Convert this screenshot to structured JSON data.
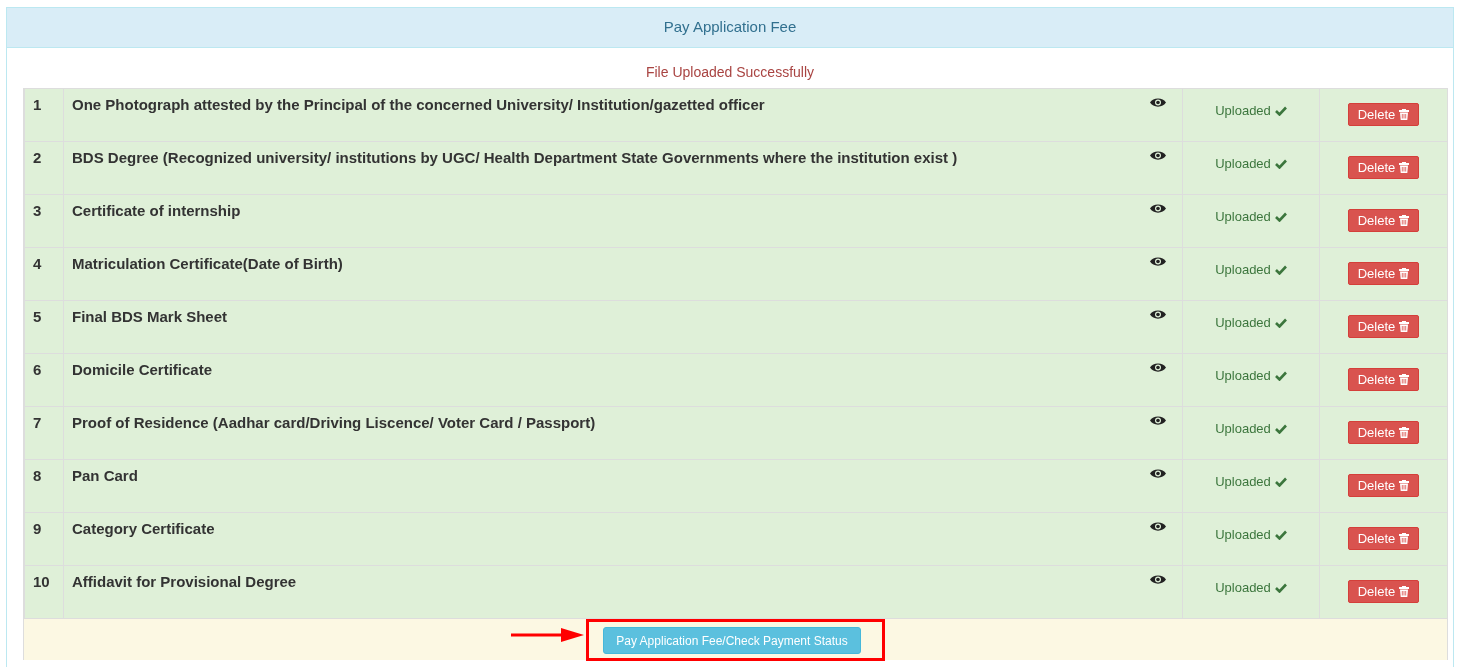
{
  "panel": {
    "title": "Pay Application Fee",
    "message": "File Uploaded Successfully"
  },
  "documents": [
    {
      "number": "1",
      "name": "One Photograph attested by the Principal of the concerned University/ Institution/gazetted officer",
      "status": "Uploaded",
      "action": "Delete"
    },
    {
      "number": "2",
      "name": "BDS Degree (Recognized university/ institutions by UGC/ Health Department State Governments where the institution exist )",
      "status": "Uploaded",
      "action": "Delete"
    },
    {
      "number": "3",
      "name": "Certificate of internship",
      "status": "Uploaded",
      "action": "Delete"
    },
    {
      "number": "4",
      "name": "Matriculation Certificate(Date of Birth)",
      "status": "Uploaded",
      "action": "Delete"
    },
    {
      "number": "5",
      "name": "Final BDS Mark Sheet",
      "status": "Uploaded",
      "action": "Delete"
    },
    {
      "number": "6",
      "name": "Domicile Certificate",
      "status": "Uploaded",
      "action": "Delete"
    },
    {
      "number": "7",
      "name": "Proof of Residence (Aadhar card/Driving Liscence/ Voter Card / Passport)",
      "status": "Uploaded",
      "action": "Delete"
    },
    {
      "number": "8",
      "name": "Pan Card",
      "status": "Uploaded",
      "action": "Delete"
    },
    {
      "number": "9",
      "name": "Category Certificate",
      "status": "Uploaded",
      "action": "Delete"
    },
    {
      "number": "10",
      "name": "Affidavit for Provisional Degree",
      "status": "Uploaded",
      "action": "Delete"
    }
  ],
  "footer": {
    "button": "Pay Application Fee/Check Payment Status"
  }
}
